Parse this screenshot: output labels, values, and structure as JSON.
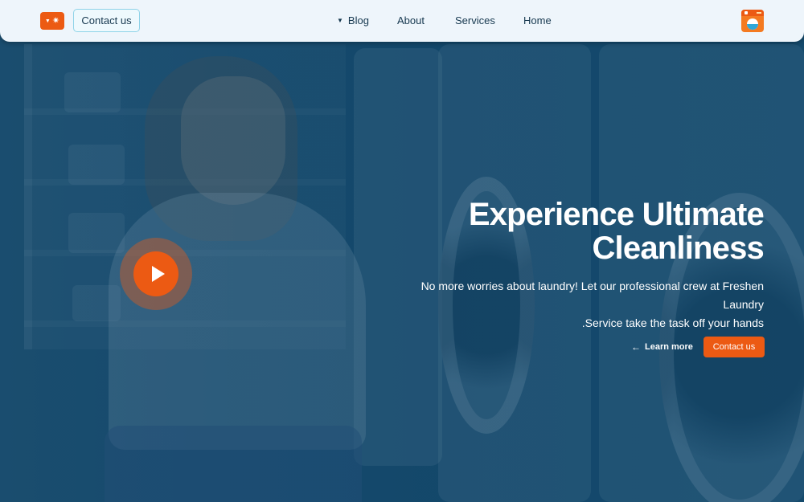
{
  "header": {
    "lang_icon": "sun-icon",
    "contact_label": "Contact us",
    "nav": [
      {
        "label": "Blog",
        "has_dropdown": true
      },
      {
        "label": "About",
        "has_dropdown": false
      },
      {
        "label": "Services",
        "has_dropdown": false
      },
      {
        "label": "Home",
        "has_dropdown": false
      }
    ],
    "logo_icon": "washing-machine-logo"
  },
  "hero": {
    "title_line1": "Experience Ultimate",
    "title_line2": "Cleanliness",
    "subtitle_line1": "No more worries about laundry! Let our professional crew at Freshen Laundry",
    "subtitle_line2": ".Service take the task off your hands",
    "learn_more_label": "Learn more",
    "contact_label": "Contact us",
    "play_icon": "play-icon"
  },
  "colors": {
    "accent": "#ec5a13",
    "header_bg": "#eef5fb",
    "overlay": "#0d466e",
    "nav_text": "#16384f"
  }
}
